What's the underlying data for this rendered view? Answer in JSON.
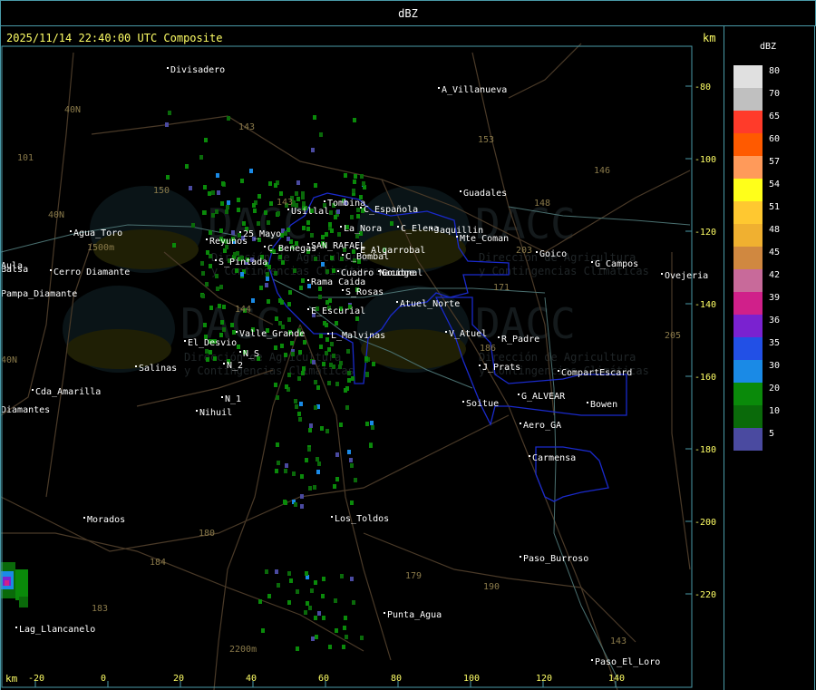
{
  "window": {
    "title": "dBZ"
  },
  "header": {
    "timestamp": "2025/11/14 22:40:00 UTC Composite",
    "km_label": "km"
  },
  "footer": {
    "km_label": "km"
  },
  "y_axis": {
    "ticks": [
      "-80",
      "-100",
      "-120",
      "-140",
      "-160",
      "-180",
      "-200",
      "-220"
    ]
  },
  "x_axis": {
    "ticks": [
      "-20",
      "0",
      "20",
      "40",
      "60",
      "80",
      "100",
      "120",
      "140"
    ]
  },
  "legend": {
    "title": "dBZ",
    "levels": [
      {
        "value": "80",
        "color": "#e0e0e0"
      },
      {
        "value": "70",
        "color": "#c0c0c0"
      },
      {
        "value": "65",
        "color": "#ff3b2a"
      },
      {
        "value": "60",
        "color": "#ff5a00"
      },
      {
        "value": "57",
        "color": "#ff9a5a"
      },
      {
        "value": "54",
        "color": "#ffff1a"
      },
      {
        "value": "51",
        "color": "#ffc830"
      },
      {
        "value": "48",
        "color": "#f0b030"
      },
      {
        "value": "45",
        "color": "#d08840"
      },
      {
        "value": "42",
        "color": "#c86a9a"
      },
      {
        "value": "39",
        "color": "#d0208a"
      },
      {
        "value": "36",
        "color": "#7a22d0"
      },
      {
        "value": "35",
        "color": "#2250e6"
      },
      {
        "value": "30",
        "color": "#1a8ae6"
      },
      {
        "value": "20",
        "color": "#0a8a0a"
      },
      {
        "value": "10",
        "color": "#0a6a0a"
      },
      {
        "value": "5",
        "color": "#4a4aa0"
      }
    ]
  },
  "places": [
    "Divisadero",
    "A_Villanueva",
    "Guadales",
    "Tombina",
    "Usillal",
    "C_Española",
    "La_Nora",
    "C_Elena",
    "Jaquillin",
    "Mte_Coman",
    "Goico",
    "G_Campos",
    "Ovejeria",
    "Agua_Toro",
    "Cerro Diamante",
    "Pampa_Diamante",
    "Reyunos",
    "25_Mayo",
    "S_Pintada",
    "C_Benegas",
    "SAN_RAFAEL",
    "E_Algarrobal",
    "C_Bombal",
    "Rama Caida",
    "Cuadro Nacional",
    "Goudge",
    "S_Rosas",
    "Atuel_Norte",
    "E_Escurial",
    "El_Desvio",
    "Valle_Grande",
    "L_Malvinas",
    "V_Atuel",
    "R_Padre",
    "Salinas",
    "N_2",
    "N_S",
    "J_Prats",
    "CompartEscard",
    "Cda_Amarilla",
    "N_1",
    "G_ALVEAR",
    "Bowen",
    "Soitue",
    "Nihuil",
    "Aero_GA",
    "Carmensa",
    "Morados",
    "Los_Toldos",
    "Paso_Burroso",
    "Punta_Agua",
    "Lag_Llancanelo",
    "Paso_El_Loro",
    "Balsa",
    "Diamantes",
    "Aula"
  ],
  "route_numbers": [
    "153",
    "146",
    "148",
    "203",
    "171",
    "143",
    "40N",
    "101",
    "150",
    "143",
    "184",
    "179",
    "180",
    "190",
    "183",
    "143",
    "205",
    "40N",
    "40N",
    "144",
    "186"
  ],
  "elevations": [
    "1500m",
    "2200m"
  ],
  "watermarks": [
    {
      "brand": "DACC",
      "line1": "Dirección de Agricultura",
      "line2": "y Contingencias Climáticas"
    },
    {
      "brand": "DACC",
      "line1": "Dirección de Agricultura",
      "line2": "y Contingencias Climáticas"
    },
    {
      "brand": "DACC",
      "line1": "Dirección de Agricultura",
      "line2": "y Contingencias Climáticas"
    },
    {
      "brand": "DACC",
      "line1": "Dirección de Agricultura",
      "line2": "y Contingencias Climáticas"
    }
  ],
  "colors": {
    "frame": "#4a9aa8",
    "axis_text": "#ffff66",
    "place_text": "#ffffff",
    "route_text": "#8a7a4a",
    "district": "#1a2acc",
    "road": "#4a3a28",
    "river": "#5a7a7a"
  }
}
